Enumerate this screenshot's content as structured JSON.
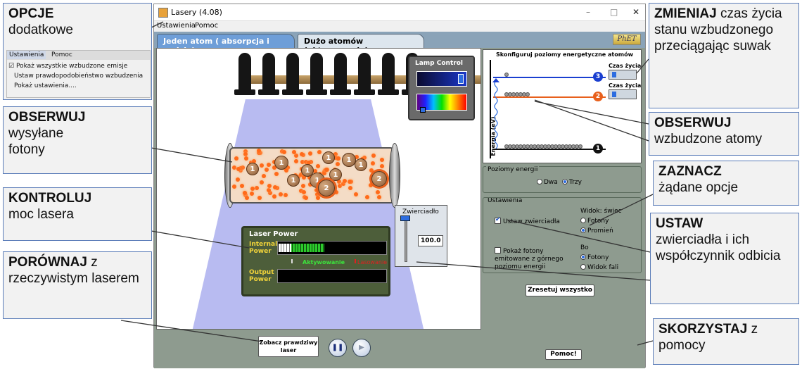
{
  "window": {
    "title": "Lasery (4.08)",
    "minimize": "–",
    "maximize": "□",
    "close": "✕"
  },
  "menubar": {
    "settings": "Ustawienia",
    "help": "Pomoc"
  },
  "tabs": [
    {
      "label": "Jeden atom ( absorpcja i emisja)"
    },
    {
      "label": "Dużo atomów (aktywowanie)"
    }
  ],
  "logo": "PhET",
  "lamp_control": {
    "title": "Lamp Control"
  },
  "tube": {
    "atom_labels": [
      "1",
      "1",
      "1",
      "1",
      "1",
      "1",
      "1",
      "1",
      "2",
      "2",
      "1"
    ]
  },
  "laser_power": {
    "title": "Laser Power",
    "internal_label": "Internal Power",
    "output_label": "Output Power",
    "activation_label": "Aktywowanie",
    "lasing_label": "Lasowanie",
    "internal_level": 0.5,
    "output_level": 0.0
  },
  "mirror": {
    "title": "Zwierciadło",
    "value": "100.0",
    "level": 1.0
  },
  "energy_diagram": {
    "title": "Skonfiguruj poziomy energetyczne atomów",
    "ylabel": "Energia (eV)",
    "lifetime_label_1": "Czas życia",
    "lifetime_label_2": "Czas życia",
    "levels": [
      "3",
      "2",
      "1"
    ]
  },
  "energy_levels": {
    "title": "Poziomy energii",
    "options": [
      "Dwa",
      "Trzy"
    ],
    "selected": "Trzy"
  },
  "settings": {
    "title": "Ustawienia",
    "mirrors_checkbox": "Ustaw zwierciadła",
    "photons_checkbox": "Pokaż fotony emitowane z górnego poziomu energii",
    "view_title": "Widok: świec",
    "view_options": [
      "Fotony",
      "Promień"
    ],
    "view_selected": "Promień",
    "view2_title": "Bo",
    "view2_options": [
      "Fotony",
      "Widok fali"
    ],
    "view2_selected": "Fotony"
  },
  "buttons": {
    "reset": "Zresetuj wszystko",
    "real_laser": "Zobacz prawdziwy laser",
    "help": "Pomoc!",
    "pause": "❚❚",
    "step": "▶"
  },
  "colors": {
    "accent_blue": "#2d6de0",
    "level3": "#1a3fd0",
    "level2": "#e8601c",
    "level1": "#111111",
    "callout_border": "#5a7cb8"
  },
  "callouts": {
    "opcje": {
      "bold": "OPCJE",
      "rest": "dodatkowe"
    },
    "opcje_menu": {
      "settings": "Ustawienia",
      "help": "Pomoc",
      "items": [
        "Pokaż wszystkie wzbudzone emisje",
        "Ustaw prawdopodobieństwo wzbudzenia",
        "Pokaż ustawienia...."
      ]
    },
    "obserwuj_fotony": {
      "bold": "OBSERWUJ",
      "rest": "wysyłane fotony"
    },
    "kontroluj": {
      "bold": "KONTROLUJ",
      "rest": "moc lasera"
    },
    "porownaj": {
      "bold": "PORÓWNAJ",
      "rest": "z rzeczywistym laserem"
    },
    "zmieniaj": {
      "bold": "ZMIENIAJ",
      "rest": "czas życia stanu wzbudzonego przeciągając suwak"
    },
    "obserwuj_atomy": {
      "bold": "OBSERWUJ",
      "rest": "wzbudzone atomy"
    },
    "zaznacz": {
      "bold": "ZAZNACZ",
      "rest": "żądane opcje"
    },
    "ustaw": {
      "bold": "USTAW",
      "rest": "zwierciadła i ich współczynnik odbicia"
    },
    "skorzystaj": {
      "bold": "SKORZYSTAJ",
      "rest": "z pomocy"
    }
  }
}
